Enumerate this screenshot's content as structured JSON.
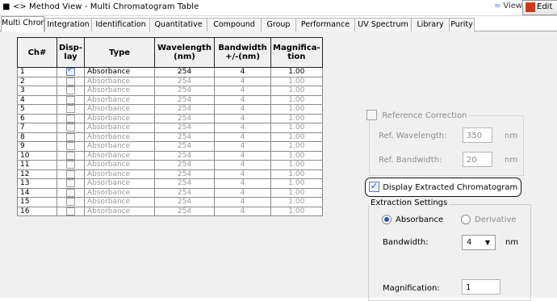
{
  "window": {
    "title": "Method View - Multi Chromatogram Table",
    "nav_icon": "<>",
    "view_label": "View",
    "edit_label": "Edit"
  },
  "tabs": [
    {
      "label": "Multi Chrom",
      "active": true
    },
    {
      "label": "Integration"
    },
    {
      "label": "Identification"
    },
    {
      "label": "Quantitative"
    },
    {
      "label": "Compound"
    },
    {
      "label": "Group"
    },
    {
      "label": "Performance"
    },
    {
      "label": "UV Spectrum"
    },
    {
      "label": "Library"
    },
    {
      "label": "Purity"
    }
  ],
  "table": {
    "headers": {
      "ch": "Ch#",
      "display": "Disp-\nlay",
      "type": "Type",
      "wavelength": "Wavelength\n(nm)",
      "bandwidth": "Bandwidth\n+/-(nm)",
      "magnification": "Magnifica-\ntion"
    },
    "rows": [
      {
        "ch": "1",
        "display": true,
        "type": "Absorbance",
        "wavelength": "254",
        "bandwidth": "4",
        "magnification": "1.00"
      },
      {
        "ch": "2",
        "display": false,
        "type": "Absorbance",
        "wavelength": "254",
        "bandwidth": "4",
        "magnification": "1.00"
      },
      {
        "ch": "3",
        "display": false,
        "type": "Absorbance",
        "wavelength": "254",
        "bandwidth": "4",
        "magnification": "1.00"
      },
      {
        "ch": "4",
        "display": false,
        "type": "Absorbance",
        "wavelength": "254",
        "bandwidth": "4",
        "magnification": "1.00"
      },
      {
        "ch": "5",
        "display": false,
        "type": "Absorbance",
        "wavelength": "254",
        "bandwidth": "4",
        "magnification": "1.00"
      },
      {
        "ch": "6",
        "display": false,
        "type": "Absorbance",
        "wavelength": "254",
        "bandwidth": "4",
        "magnification": "1.00"
      },
      {
        "ch": "7",
        "display": false,
        "type": "Absorbance",
        "wavelength": "254",
        "bandwidth": "4",
        "magnification": "1.00"
      },
      {
        "ch": "8",
        "display": false,
        "type": "Absorbance",
        "wavelength": "254",
        "bandwidth": "4",
        "magnification": "1.00"
      },
      {
        "ch": "9",
        "display": false,
        "type": "Absorbance",
        "wavelength": "254",
        "bandwidth": "4",
        "magnification": "1.00"
      },
      {
        "ch": "10",
        "display": false,
        "type": "Absorbance",
        "wavelength": "254",
        "bandwidth": "4",
        "magnification": "1.00"
      },
      {
        "ch": "11",
        "display": false,
        "type": "Absorbance",
        "wavelength": "254",
        "bandwidth": "4",
        "magnification": "1.00"
      },
      {
        "ch": "12",
        "display": false,
        "type": "Absorbance",
        "wavelength": "254",
        "bandwidth": "4",
        "magnification": "1.00"
      },
      {
        "ch": "13",
        "display": false,
        "type": "Absorbance",
        "wavelength": "254",
        "bandwidth": "4",
        "magnification": "1.00"
      },
      {
        "ch": "14",
        "display": false,
        "type": "Absorbance",
        "wavelength": "254",
        "bandwidth": "4",
        "magnification": "1.00"
      },
      {
        "ch": "15",
        "display": false,
        "type": "Absorbance",
        "wavelength": "254",
        "bandwidth": "4",
        "magnification": "1.00"
      },
      {
        "ch": "16",
        "display": false,
        "type": "Absorbance",
        "wavelength": "254",
        "bandwidth": "4",
        "magnification": "1.00"
      }
    ]
  },
  "reference_correction": {
    "label": "Reference Correction",
    "checked": false,
    "ref_wavelength_label": "Ref. Wavelength:",
    "ref_wavelength_value": "350",
    "ref_bandwidth_label": "Ref. Bandwidth:",
    "ref_bandwidth_value": "20",
    "unit": "nm"
  },
  "display_extracted": {
    "label": "Display Extracted Chromatogram",
    "checked": true
  },
  "extraction_settings": {
    "title": "Extraction Settings",
    "absorbance_label": "Absorbance",
    "derivative_label": "Derivative",
    "selected": "absorbance",
    "bandwidth_label": "Bandwidth:",
    "bandwidth_value": "4",
    "unit": "nm",
    "magnification_label": "Magnification:",
    "magnification_value": "1"
  },
  "colors": {
    "checkbox_check": "#2b4a8f",
    "radio_selected": "#2a56b8",
    "edit_icon": "#cc3a1a",
    "panel_bg": "#f0f0f0"
  }
}
